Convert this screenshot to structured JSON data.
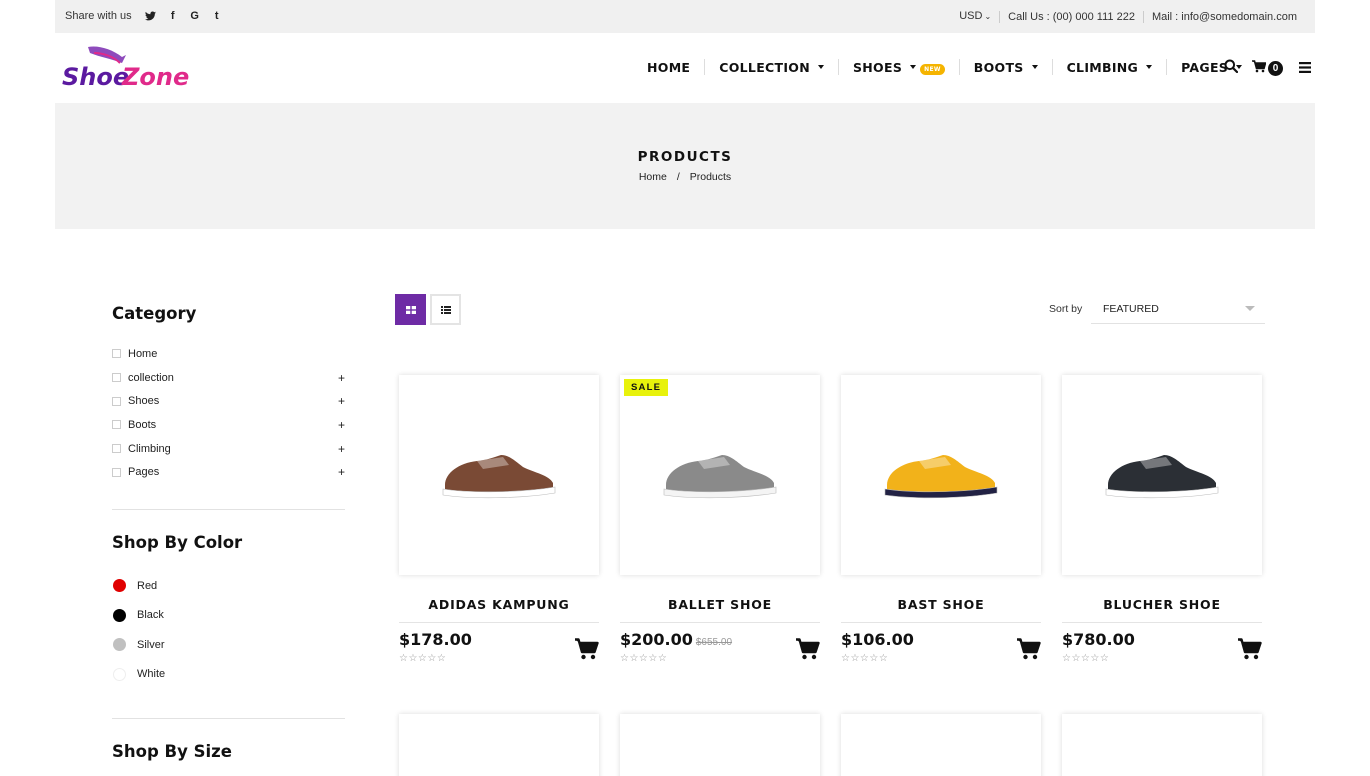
{
  "topbar": {
    "share_label": "Share with us",
    "social": [
      {
        "icon": "twitter-icon",
        "glyph": "🐦"
      },
      {
        "icon": "facebook-icon",
        "glyph": "f"
      },
      {
        "icon": "google-icon",
        "glyph": "G"
      },
      {
        "icon": "tumblr-icon",
        "glyph": "t"
      }
    ],
    "currency": "USD",
    "call": "Call Us : (00) 000 111 222",
    "mail": "Mail : info@somedomain.com"
  },
  "header": {
    "logo_text_1": "Shoe",
    "logo_text_2": "Zone",
    "nav": [
      {
        "label": "HOME",
        "dropdown": false
      },
      {
        "label": "COLLECTION",
        "dropdown": true
      },
      {
        "label": "SHOES",
        "dropdown": true,
        "badge": "NEW"
      },
      {
        "label": "BOOTS",
        "dropdown": true
      },
      {
        "label": "CLIMBING",
        "dropdown": true
      },
      {
        "label": "PAGES",
        "dropdown": true
      }
    ],
    "cart_count": "0"
  },
  "banner": {
    "title": "PRODUCTS",
    "crumb_home": "Home",
    "crumb_sep": "/",
    "crumb_current": "Products"
  },
  "sidebar": {
    "category_title": "Category",
    "categories": [
      {
        "label": "Home",
        "expandable": false
      },
      {
        "label": "collection",
        "expandable": true
      },
      {
        "label": "Shoes",
        "expandable": true
      },
      {
        "label": "Boots",
        "expandable": true
      },
      {
        "label": "Climbing",
        "expandable": true
      },
      {
        "label": "Pages",
        "expandable": true
      }
    ],
    "color_title": "Shop By Color",
    "colors": [
      {
        "label": "Red",
        "hex": "#e00000"
      },
      {
        "label": "Black",
        "hex": "#000000"
      },
      {
        "label": "Silver",
        "hex": "#c0c0c0"
      },
      {
        "label": "White",
        "hex": "#ffffff"
      }
    ],
    "size_title": "Shop By Size"
  },
  "toolbar": {
    "sort_label": "Sort by",
    "sort_value": "FEATURED"
  },
  "products": [
    {
      "name": "ADIDAS KAMPUNG",
      "price": "$178.00",
      "old_price": "",
      "sale": false,
      "rating": 0,
      "shoe_color": "#7a4a35",
      "sole_color": "#ffffff"
    },
    {
      "name": "BALLET SHOE",
      "price": "$200.00",
      "old_price": "$655.00",
      "sale": true,
      "sale_label": "SALE",
      "rating": 0,
      "shoe_color": "#8a8a8a",
      "sole_color": "#f4f4f4"
    },
    {
      "name": "BAST SHOE",
      "price": "$106.00",
      "old_price": "",
      "sale": false,
      "rating": 0,
      "shoe_color": "#f2b21a",
      "sole_color": "#222244"
    },
    {
      "name": "BLUCHER SHOE",
      "price": "$780.00",
      "old_price": "",
      "sale": false,
      "rating": 0,
      "shoe_color": "#2b2f35",
      "sole_color": "#ffffff"
    }
  ],
  "colors": {
    "accent": "#6e2ba5",
    "sale_badge": "#e8f20c",
    "new_badge": "#f5b400",
    "banner_bg": "#f2f2f2",
    "topbar_bg": "#f0f0f0"
  }
}
